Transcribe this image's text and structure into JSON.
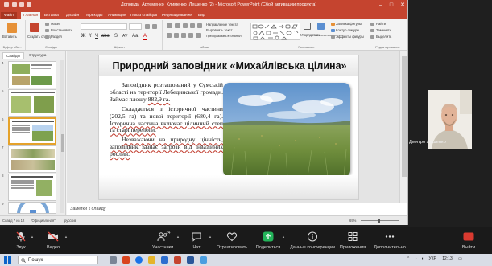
{
  "window": {
    "title": "Доповідь_Артеменко_Клименко_Лещенко (2) - Microsoft PowerPoint (Сбой активации продукта)"
  },
  "ribbon_tabs": [
    "Файл",
    "Главная",
    "Вставка",
    "Дизайн",
    "Переходы",
    "Анимация",
    "Показ слайдов",
    "Рецензирование",
    "Вид"
  ],
  "ribbon": {
    "groups": [
      "Буфер обм...",
      "Слайды",
      "Шрифт",
      "Абзац",
      "Рисование",
      "Редактирование"
    ],
    "buttons": {
      "paste": "Вставить",
      "new_slide": "Создать слайд",
      "layout": "Макет",
      "reset": "Восстановить",
      "section": "Раздел",
      "arrange": "Упорядочить",
      "quick_styles": "Экспресс-стили",
      "shape_fill": "Заливка фигуры",
      "shape_outline": "Контур фигуры",
      "shape_effects": "Эффекты фигуры",
      "find": "Найти",
      "replace": "Заменить",
      "select": "Выделить",
      "text_direction": "Направление текста",
      "align_text": "Выровнять текст",
      "smartart": "Преобразовать в SmartArt"
    }
  },
  "left_panel": {
    "tabs": [
      "Слайды",
      "Структура"
    ],
    "slide_numbers": [
      "4",
      "5",
      "6",
      "7",
      "8",
      "9",
      "10"
    ]
  },
  "slide": {
    "title": "Природний заповідник «Михайлівська цілина»",
    "p1a": "Заповідник розташований у Сумській області на території Лебединської громади. Займає площу ",
    "p1b": "882,9",
    "p1c": "га.",
    "p2a": "Складається з історичної частини (202,5 га) та нової території (680,4 га). ",
    "p2b": "Історична частина включає цілинний степ та старі перелоги.",
    "p3a": "Незважаючи на природну цінність, заповідник зазнає загрози від інвазійних рослин."
  },
  "notes": {
    "placeholder": "Заметки к слайду"
  },
  "status": {
    "slide": "Слайд 7 из 12",
    "theme": "\"Официальная\"",
    "language": "русский",
    "zoom": "69%"
  },
  "participant": {
    "name": "Дмитро Лещенко"
  },
  "meeting_toolbar": {
    "items": [
      {
        "label": "Звук",
        "icon": "microphone-off-icon"
      },
      {
        "label": "Видео",
        "icon": "video-off-icon"
      },
      {
        "label": "Участники",
        "icon": "participants-icon",
        "count": "24"
      },
      {
        "label": "Чат",
        "icon": "chat-icon"
      },
      {
        "label": "Отреагировать",
        "icon": "heart-icon"
      },
      {
        "label": "Поделиться",
        "icon": "share-icon"
      },
      {
        "label": "Данные конференции",
        "icon": "info-icon"
      },
      {
        "label": "Приложения",
        "icon": "apps-icon"
      },
      {
        "label": "Дополнительно",
        "icon": "more-icon"
      },
      {
        "label": "Выйти",
        "icon": "leave-icon"
      }
    ],
    "leave_color": "#d93a30"
  },
  "taskbar": {
    "search_placeholder": "Пошук",
    "language": "УКР",
    "time": "12:13"
  },
  "colors": {
    "ppt_accent": "#c5442f",
    "selected_thumb": "#e5a22a"
  }
}
